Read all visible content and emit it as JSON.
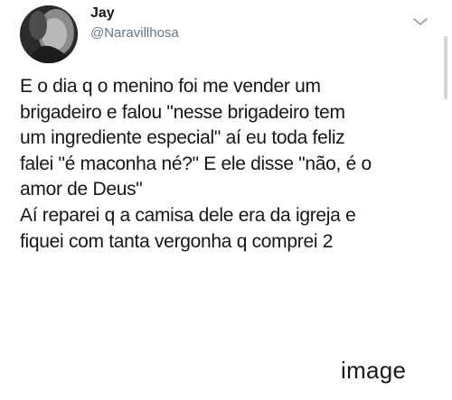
{
  "tweet": {
    "author": {
      "display_name": "Jay",
      "handle": "@Naravillhosa",
      "avatar_icon": "profile-photo"
    },
    "menu_icon": "chevron-down-icon",
    "lines": [
      "E o dia q o menino foi me vender um",
      "brigadeiro e falou \"nesse brigadeiro tem",
      "um ingrediente especial\" aí eu toda feliz",
      "falei \"é maconha né?\" E ele disse \"não, é o",
      "amor de Deus\"",
      "Aí reparei q a camisa dele era da igreja e",
      "fiquei com tanta vergonha q comprei 2"
    ]
  },
  "caption": "image",
  "colors": {
    "handle": "#657786",
    "text": "#161616",
    "background": "#ffffff"
  }
}
